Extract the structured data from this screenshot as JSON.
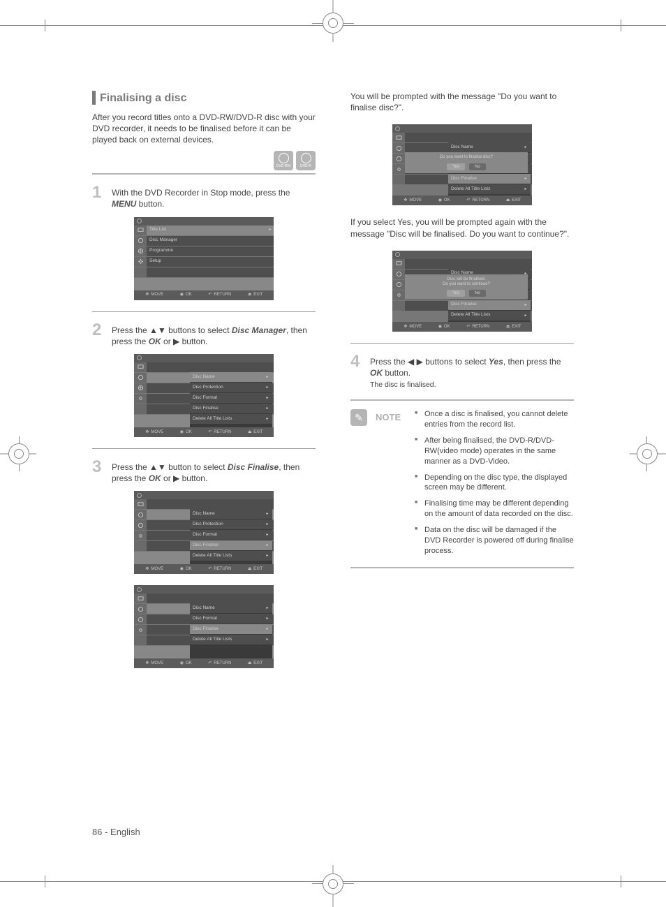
{
  "title": "Finalising a disc",
  "intro": "After you record titles onto a DVD-RW/DVD-R disc with your DVD recorder, it needs to be finalised before it can be played back on external devices.",
  "discIcons": [
    "DVD-RW",
    "DVD-R"
  ],
  "steps": {
    "s1": {
      "num": "1",
      "pre": "With the DVD Recorder in Stop mode, press the ",
      "btn": "MENU",
      "post": " button."
    },
    "s2": {
      "num": "2",
      "pre": "Press the ▲▼ buttons to select ",
      "sel": "Disc Manager",
      "mid": ", then press the ",
      "btn": "OK",
      "post": " or ▶ button."
    },
    "s3": {
      "num": "3",
      "pre": "Press the ▲▼ button to select ",
      "sel": "Disc Finalise",
      "mid": ", then press the ",
      "btn": "OK",
      "post": " or ▶ button."
    },
    "s4": {
      "num": "4",
      "pre": "Press the ◀ ▶ buttons to select ",
      "sel": "Yes",
      "mid": ", then press the ",
      "btn": "OK",
      "post": " button.",
      "sub": "The disc is finalised."
    }
  },
  "prompt1": "You will be prompted with the message \"Do you want to finalise disc?\".",
  "prompt2": "If you select Yes, you will be prompted again with the message \"Disc will be finalised. Do you want to continue?\".",
  "menu": {
    "leftItems": [
      {
        "icon": "tv",
        "label": "Title List"
      },
      {
        "icon": "disc",
        "label": "Disc Manager"
      },
      {
        "icon": "globe",
        "label": "Programme"
      },
      {
        "icon": "gear",
        "label": "Setup"
      }
    ],
    "discManager": [
      "Disc Name",
      "Disc Protection",
      "Disc Format",
      "Disc Finalise",
      "Delete All Title Lists"
    ],
    "discManagerR": [
      "Disc Name",
      "Disc Format",
      "Disc Finalise",
      "Delete All Title Lists"
    ],
    "bottom": [
      {
        "ic": "✥",
        "t": "MOVE"
      },
      {
        "ic": "◉",
        "t": "OK"
      },
      {
        "ic": "↶",
        "t": "RETURN"
      },
      {
        "ic": "⏏",
        "t": "EXIT"
      }
    ],
    "dialog1": "Do you want to finalise disc?",
    "dialog2": "Disc will be finalised.\nDo you want to continue?",
    "yes": "Yes",
    "no": "No"
  },
  "noteLabel": "NOTE",
  "notes": [
    "Once a disc is finalised, you cannot delete entries from the record list.",
    "After being finalised, the DVD-R/DVD-RW(video mode) operates in the same manner as a DVD-Video.",
    "Depending on the disc type, the displayed screen may be different.",
    "Finalising time may be different depending on the amount of data recorded on the disc.",
    "Data on the disc will be damaged if the DVD Recorder is powered off during finalise process."
  ],
  "pageNumber": "86",
  "pageLang": "- English"
}
